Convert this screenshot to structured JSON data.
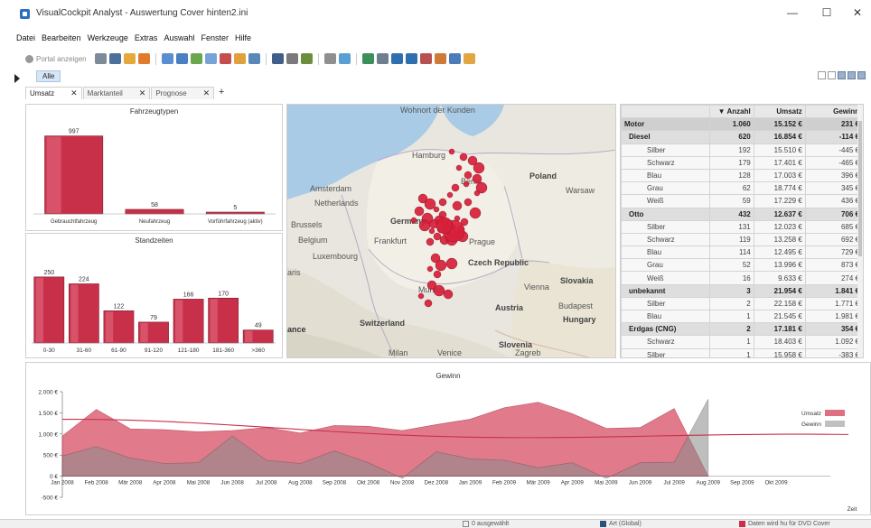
{
  "window": {
    "title": "VisualCockpit Analyst - Auswertung Cover hinten2.ini",
    "minimize": "—",
    "maximize": "☐",
    "close": "✕"
  },
  "menu": [
    "Datei",
    "Bearbeiten",
    "Werkzeuge",
    "Extras",
    "Auswahl",
    "Fenster",
    "Hilfe"
  ],
  "toolbar": {
    "portal_label": "Portal anzeigen"
  },
  "filter": {
    "pill": "Alle"
  },
  "tabs": [
    {
      "label": "Umsatz",
      "close": "✕"
    },
    {
      "label": "Marktanteil",
      "close": "✕"
    },
    {
      "label": "Prognose",
      "close": "✕"
    }
  ],
  "tab_add": "+",
  "map": {
    "labels": [
      {
        "text": "Wohnort der Kunden",
        "size": 8
      },
      {
        "text": "Poland",
        "size": 13
      },
      {
        "text": "Hamburg",
        "size": 8
      },
      {
        "text": "Berlin",
        "size": 8
      },
      {
        "text": "Warsaw",
        "size": 7
      },
      {
        "text": "Amsterdam",
        "size": 7
      },
      {
        "text": "Netherlands",
        "size": 8
      },
      {
        "text": "Brussels",
        "size": 7
      },
      {
        "text": "Germany",
        "size": 13
      },
      {
        "text": "Belgium",
        "size": 8
      },
      {
        "text": "Frankfurt",
        "size": 8
      },
      {
        "text": "Prague",
        "size": 8
      },
      {
        "text": "Luxembourg",
        "size": 7
      },
      {
        "text": "Czech Republic",
        "size": 9
      },
      {
        "text": "aris",
        "size": 8
      },
      {
        "text": "Slovakia",
        "size": 8
      },
      {
        "text": "Munich",
        "size": 8
      },
      {
        "text": "Vienna",
        "size": 7
      },
      {
        "text": "Austria",
        "size": 9
      },
      {
        "text": "Budapest",
        "size": 7
      },
      {
        "text": "Hungary",
        "size": 9
      },
      {
        "text": "Switzerland",
        "size": 8
      },
      {
        "text": "ance",
        "size": 13
      },
      {
        "text": "Slovenia",
        "size": 7
      },
      {
        "text": "Milan",
        "size": 7
      },
      {
        "text": "Venice",
        "size": 7
      },
      {
        "text": "Zagreb",
        "size": 7
      }
    ]
  },
  "pivot": {
    "headers": [
      "",
      "▼ Anzahl",
      "Umsatz",
      "Gewinn"
    ],
    "rows": [
      {
        "level": 0,
        "label": "Motor",
        "anzahl": "1.060",
        "umsatz": "15.152 €",
        "gewinn": "231 €"
      },
      {
        "level": 1,
        "label": "Diesel",
        "anzahl": "620",
        "umsatz": "16.854 €",
        "gewinn": "-114 €"
      },
      {
        "level": 2,
        "label": "Silber",
        "anzahl": "192",
        "umsatz": "15.510 €",
        "gewinn": "-445 €"
      },
      {
        "level": 2,
        "label": "Schwarz",
        "anzahl": "179",
        "umsatz": "17.401 €",
        "gewinn": "-465 €"
      },
      {
        "level": 2,
        "label": "Blau",
        "anzahl": "128",
        "umsatz": "17.003 €",
        "gewinn": "396 €"
      },
      {
        "level": 2,
        "label": "Grau",
        "anzahl": "62",
        "umsatz": "18.774 €",
        "gewinn": "345 €"
      },
      {
        "level": 2,
        "label": "Weiß",
        "anzahl": "59",
        "umsatz": "17.229 €",
        "gewinn": "436 €"
      },
      {
        "level": 1,
        "label": "Otto",
        "anzahl": "432",
        "umsatz": "12.637 €",
        "gewinn": "706 €"
      },
      {
        "level": 2,
        "label": "Silber",
        "anzahl": "131",
        "umsatz": "12.023 €",
        "gewinn": "685 €"
      },
      {
        "level": 2,
        "label": "Schwarz",
        "anzahl": "119",
        "umsatz": "13.258 €",
        "gewinn": "692 €"
      },
      {
        "level": 2,
        "label": "Blau",
        "anzahl": "114",
        "umsatz": "12.495 €",
        "gewinn": "729 €"
      },
      {
        "level": 2,
        "label": "Grau",
        "anzahl": "52",
        "umsatz": "13.996 €",
        "gewinn": "873 €"
      },
      {
        "level": 2,
        "label": "Weiß",
        "anzahl": "16",
        "umsatz": "9.633 €",
        "gewinn": "274 €"
      },
      {
        "level": 1,
        "label": "unbekannt",
        "anzahl": "3",
        "umsatz": "21.954 €",
        "gewinn": "1.841 €"
      },
      {
        "level": 2,
        "label": "Silber",
        "anzahl": "2",
        "umsatz": "22.158 €",
        "gewinn": "1.771 €"
      },
      {
        "level": 2,
        "label": "Blau",
        "anzahl": "1",
        "umsatz": "21.545 €",
        "gewinn": "1.981 €"
      },
      {
        "level": 1,
        "label": "Erdgas (CNG)",
        "anzahl": "2",
        "umsatz": "17.181 €",
        "gewinn": "354 €"
      },
      {
        "level": 2,
        "label": "Schwarz",
        "anzahl": "1",
        "umsatz": "18.403 €",
        "gewinn": "1.092 €"
      },
      {
        "level": 2,
        "label": "Silber",
        "anzahl": "1",
        "umsatz": "15.958 €",
        "gewinn": "-383 €"
      }
    ]
  },
  "status": {
    "item1": "0 ausgewählt",
    "item2": "Art (Global)",
    "item3": "Daten wird hu für DVD Cover"
  },
  "colors": {
    "bar": "#c8304a",
    "area": "#d9576c",
    "grey": "#c0c0c0"
  },
  "chart_data": [
    {
      "type": "bar",
      "title": "Fahrzeugtypen",
      "categories": [
        "Gebrauchtfahrzeug",
        "Neufahrzeug",
        "Vorführfahrzeug (aktiv)"
      ],
      "values": [
        997,
        58,
        5
      ],
      "ylim": [
        0,
        1050
      ]
    },
    {
      "type": "bar",
      "title": "Standzeiten",
      "categories": [
        "0-30",
        "31-60",
        "61-90",
        "91-120",
        "121-180",
        "181-360",
        ">360"
      ],
      "values": [
        250,
        224,
        122,
        79,
        166,
        170,
        49
      ],
      "ylim": [
        0,
        270
      ]
    },
    {
      "type": "area",
      "title": "Gewinn",
      "xlabel": "Zeit",
      "ylabel": "",
      "ylim": [
        -500,
        2000
      ],
      "yticks": [
        "2.000 €",
        "1.500 €",
        "1.000 €",
        "500 €",
        "0 €",
        "-500 €"
      ],
      "ytick_values": [
        2000,
        1500,
        1000,
        500,
        0,
        -500
      ],
      "x": [
        "Jan 2008",
        "Feb 2008",
        "Mär 2008",
        "Apr 2008",
        "Mai 2008",
        "Jun 2008",
        "Jul 2008",
        "Aug 2008",
        "Sep 2008",
        "Okt 2008",
        "Nov 2008",
        "Dez 2008",
        "Jan 2009",
        "Feb 2009",
        "Mär 2009",
        "Apr 2009",
        "Mai 2009",
        "Jun 2009",
        "Jul 2009",
        "Aug 2009",
        "Sep 2009",
        "Okt 2009"
      ],
      "legend": "right",
      "series": [
        {
          "name": "Umsatz",
          "values": [
            950,
            1580,
            1120,
            1100,
            1050,
            1080,
            1150,
            1020,
            1200,
            1180,
            1080,
            1220,
            1350,
            1620,
            1750,
            1480,
            1130,
            1150,
            1600,
            0,
            null,
            null
          ]
        },
        {
          "name": "Gewinn",
          "values": [
            480,
            700,
            430,
            300,
            320,
            950,
            380,
            300,
            600,
            320,
            -50,
            580,
            410,
            380,
            200,
            320,
            -50,
            320,
            330,
            1820,
            null,
            null
          ]
        }
      ]
    }
  ]
}
